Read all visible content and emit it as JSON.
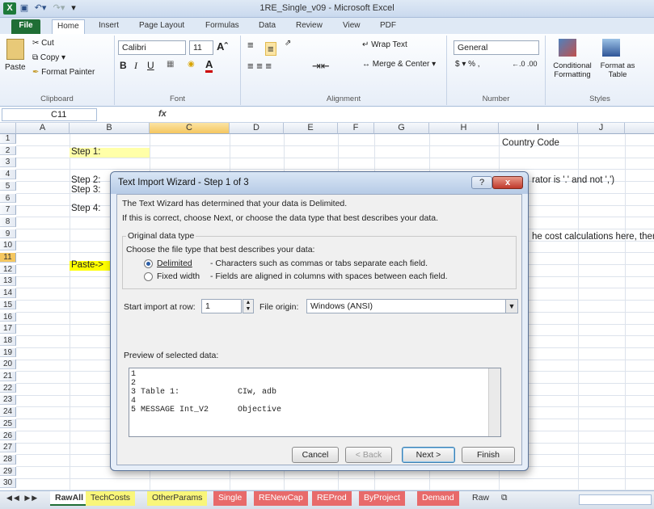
{
  "window": {
    "title": "1RE_Single_v09 - Microsoft Excel"
  },
  "ribbon": {
    "tabs": [
      "File",
      "Home",
      "Insert",
      "Page Layout",
      "Formulas",
      "Data",
      "Review",
      "View",
      "PDF"
    ],
    "clipboard": {
      "cut": "Cut",
      "copy": "Copy",
      "paste": "Paste",
      "format_painter": "Format Painter",
      "label": "Clipboard"
    },
    "font": {
      "name": "Calibri",
      "size": "11",
      "label": "Font"
    },
    "alignment": {
      "wrap": "Wrap Text",
      "merge": "Merge & Center",
      "label": "Alignment"
    },
    "number": {
      "format": "General",
      "label": "Number"
    },
    "styles": {
      "conditional": "Conditional Formatting",
      "format_table": "Format as Table",
      "label": "Styles"
    }
  },
  "formula_bar": {
    "name_box": "C11",
    "fx": "fx"
  },
  "grid": {
    "columns": [
      "A",
      "B",
      "C",
      "D",
      "E",
      "F",
      "G",
      "H",
      "I",
      "J"
    ],
    "selected_column": "C",
    "selected_row": "11",
    "rows": [
      "1",
      "2",
      "3",
      "4",
      "5",
      "6",
      "7",
      "8",
      "9",
      "10",
      "11",
      "12",
      "13",
      "14",
      "15",
      "16",
      "17",
      "18",
      "19",
      "20",
      "21",
      "22",
      "23",
      "24",
      "25",
      "26",
      "27",
      "28",
      "29",
      "30"
    ],
    "cells": {
      "i1": "Country Code",
      "b2": "Step 1:",
      "b4": "Step 2:",
      "b5": "Step 3:",
      "b7": "Step 4:",
      "b11": "Paste->",
      "i4": "rator is '.' and not ',')",
      "i9": "he cost calculations here, ther"
    }
  },
  "sheets": [
    "RawAll",
    "TechCosts",
    "OtherParams",
    "Single",
    "RENewCap",
    "REProd",
    "ByProject",
    "Demand",
    "Raw"
  ],
  "sheet_colors": {
    "TechCosts": "#f9f67a",
    "OtherParams": "#f9f67a",
    "Single": "#e86a6a",
    "RENewCap": "#e86a6a",
    "REProd": "#e86a6a",
    "ByProject": "#e86a6a",
    "Demand": "#e86a6a"
  },
  "dialog": {
    "title": "Text Import Wizard - Step 1 of 3",
    "help": "?",
    "close": "x",
    "line1": "The Text Wizard has determined that your data is Delimited.",
    "line2": "If this is correct, choose Next, or choose the data type that best describes your data.",
    "group_label": "Original data type",
    "group_prompt": "Choose the file type that best describes your data:",
    "opt1_label": "Delimited",
    "opt1_desc": "- Characters such as commas or tabs separate each field.",
    "opt2_label": "Fixed width",
    "opt2_desc": "- Fields are aligned in columns with spaces between each field.",
    "start_label": "Start import at row:",
    "start_value": "1",
    "origin_label": "File origin:",
    "origin_value": "Windows (ANSI)",
    "preview_label": "Preview of selected data:",
    "preview_rows": [
      "1",
      "2",
      "3 Table 1:            CIw, adb",
      "4",
      "5 MESSAGE Int_V2      Objective"
    ],
    "buttons": {
      "cancel": "Cancel",
      "back": "< Back",
      "next": "Next >",
      "finish": "Finish"
    }
  }
}
